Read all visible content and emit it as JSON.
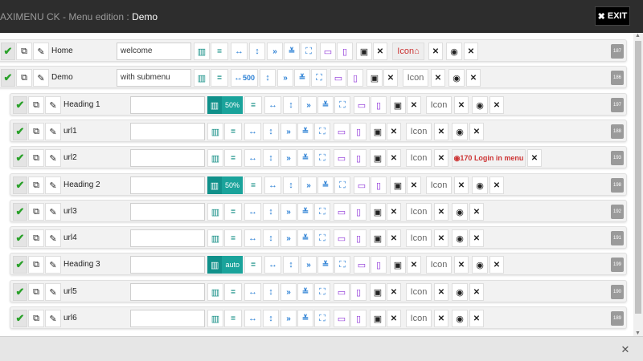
{
  "header": {
    "title_prefix": "AXIMENU CK - Menu edition : ",
    "title_name": "Demo",
    "exit_label": "EXIT"
  },
  "colors": {
    "topbar": "#2d2d2d",
    "teal": "#10908a",
    "check": "#2aa12a",
    "blue": "#2a7fd4",
    "purple": "#8a2bd6",
    "login": "#cc3333"
  },
  "icons": {
    "check": "check-icon",
    "edit": "external-link-icon",
    "pencil": "pencil-icon",
    "columns": "columns-icon",
    "equals": "align-equal-icon",
    "width": "horizontal-arrows-icon",
    "height": "vertical-arrows-icon",
    "right": "double-chevron-right-icon",
    "down": "double-chevron-down-icon",
    "fullscreen": "fullscreen-icon",
    "desktop": "desktop-icon",
    "mobile": "mobile-icon",
    "image": "image-icon",
    "close": "close-icon",
    "database": "database-icon",
    "home": "home-icon"
  },
  "items": [
    {
      "title": "Home",
      "input": "welcome",
      "col_value": "",
      "width_value": "",
      "icon_label": "Icon",
      "icon_active": true,
      "module": "",
      "id": "187",
      "level": 1
    },
    {
      "title": "Demo",
      "input": "with submenu",
      "col_value": "",
      "width_value": "500",
      "icon_label": "Icon",
      "icon_active": false,
      "module": "",
      "id": "186",
      "level": 1
    },
    {
      "title": "Heading 1",
      "input": "",
      "col_value": "50%",
      "width_value": "",
      "icon_label": "Icon",
      "icon_active": false,
      "module": "",
      "id": "197",
      "level": 2
    },
    {
      "title": "url1",
      "input": "",
      "col_value": "",
      "width_value": "",
      "icon_label": "Icon",
      "icon_active": false,
      "module": "",
      "id": "188",
      "level": 2
    },
    {
      "title": "url2",
      "input": "",
      "col_value": "",
      "width_value": "",
      "icon_label": "Icon",
      "icon_active": false,
      "module": "170 Login in menu",
      "id": "193",
      "level": 2
    },
    {
      "title": "Heading 2",
      "input": "",
      "col_value": "50%",
      "width_value": "",
      "icon_label": "Icon",
      "icon_active": false,
      "module": "",
      "id": "198",
      "level": 2
    },
    {
      "title": "url3",
      "input": "",
      "col_value": "",
      "width_value": "",
      "icon_label": "Icon",
      "icon_active": false,
      "module": "",
      "id": "192",
      "level": 2
    },
    {
      "title": "url4",
      "input": "",
      "col_value": "",
      "width_value": "",
      "icon_label": "Icon",
      "icon_active": false,
      "module": "",
      "id": "191",
      "level": 2
    },
    {
      "title": "Heading 3",
      "input": "",
      "col_value": "auto",
      "width_value": "",
      "icon_label": "Icon",
      "icon_active": false,
      "module": "",
      "id": "199",
      "level": 2
    },
    {
      "title": "url5",
      "input": "",
      "col_value": "",
      "width_value": "",
      "icon_label": "Icon",
      "icon_active": false,
      "module": "",
      "id": "190",
      "level": 2
    },
    {
      "title": "url6",
      "input": "",
      "col_value": "",
      "width_value": "",
      "icon_label": "Icon",
      "icon_active": false,
      "module": "",
      "id": "189",
      "level": 2
    }
  ]
}
